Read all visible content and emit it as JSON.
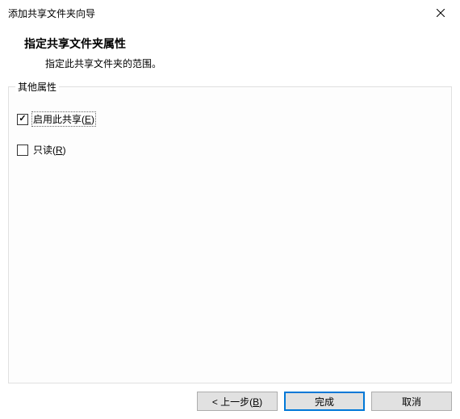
{
  "titlebar": {
    "title": "添加共享文件夹向导"
  },
  "header": {
    "title": "指定共享文件夹属性",
    "subtitle": "指定此共享文件夹的范围。"
  },
  "fieldset": {
    "label": "其他属性"
  },
  "checkboxes": {
    "enable": {
      "label_pre": "启用此共享(",
      "label_key": "E",
      "label_post": ")",
      "checked": true
    },
    "readonly": {
      "label_pre": "只读(",
      "label_key": "R",
      "label_post": ")",
      "checked": false
    }
  },
  "buttons": {
    "back": {
      "label_pre": "< 上一步(",
      "label_key": "B",
      "label_post": ")"
    },
    "finish": {
      "label": "完成"
    },
    "cancel": {
      "label": "取消"
    }
  }
}
